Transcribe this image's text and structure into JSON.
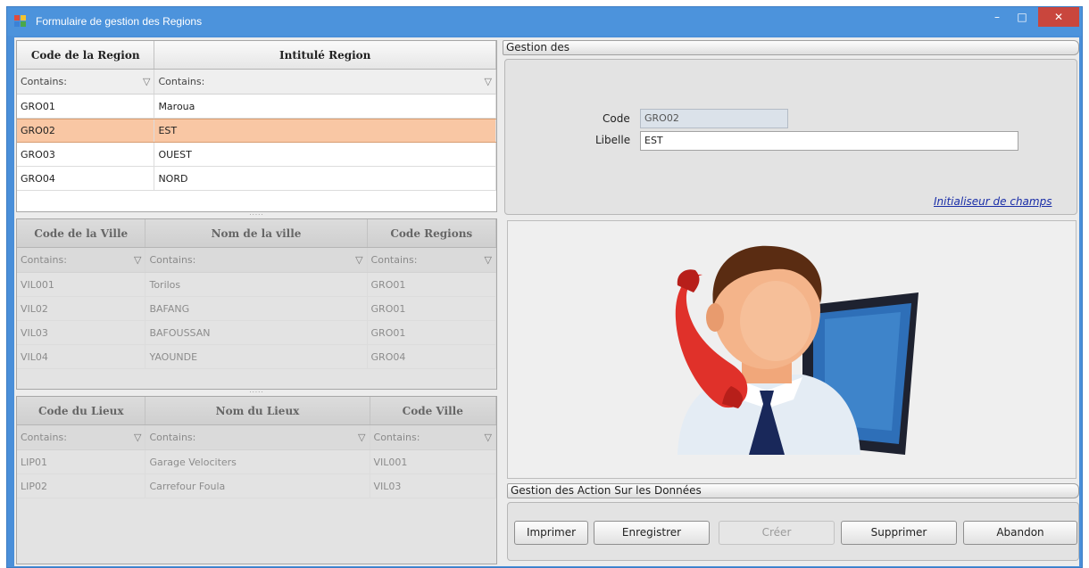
{
  "window": {
    "title": "Formulaire de gestion des Regions",
    "controls": {
      "minimize": "–",
      "maximize": "□",
      "close": "✕"
    }
  },
  "regions_grid": {
    "columns": [
      "Code  de la Region",
      "Intitulé Region"
    ],
    "filters": [
      "Contains:",
      "Contains:"
    ],
    "rows": [
      [
        "GRO01",
        "Maroua"
      ],
      [
        "GRO02",
        "EST"
      ],
      [
        "GRO03",
        "OUEST"
      ],
      [
        "GRO04",
        "NORD"
      ]
    ],
    "selected_row": 1
  },
  "villes_grid": {
    "columns": [
      "Code  de la Ville",
      "Nom de la ville",
      "Code Regions"
    ],
    "filters": [
      "Contains:",
      "Contains:",
      "Contains:"
    ],
    "rows": [
      [
        "VIL001",
        "Torilos",
        "GRO01"
      ],
      [
        "VIL02",
        "BAFANG",
        "GRO01"
      ],
      [
        "VIL03",
        "BAFOUSSAN",
        "GRO01"
      ],
      [
        "VIL04",
        "YAOUNDE",
        "GRO04"
      ]
    ]
  },
  "lieux_grid": {
    "columns": [
      "Code  du Lieux",
      "Nom du Lieux",
      "Code Ville"
    ],
    "filters": [
      "Contains:",
      "Contains:",
      "Contains:"
    ],
    "rows": [
      [
        "LIP01",
        "Garage Velociters",
        "VIL001"
      ],
      [
        "LIP02",
        "Carrefour Foula",
        "VIL03"
      ]
    ]
  },
  "gestion": {
    "header": "Gestion des",
    "code_label": "Code",
    "code_value": "GRO02",
    "libelle_label": "Libelle",
    "libelle_value": "EST",
    "init_link": "Initialiseur de champs"
  },
  "illustration": {
    "icon": "call-center-operator-icon"
  },
  "actions": {
    "header": "Gestion des Action Sur les Données",
    "imprimer": "Imprimer",
    "enregistrer": "Enregistrer",
    "creer": "Créer",
    "supprimer": "Supprimer",
    "abandon": "Abandon"
  },
  "colors": {
    "titlebar": "#4c93dc",
    "selection": "#f9c7a4",
    "close_button": "#c9463d",
    "link": "#1a2ea8"
  }
}
